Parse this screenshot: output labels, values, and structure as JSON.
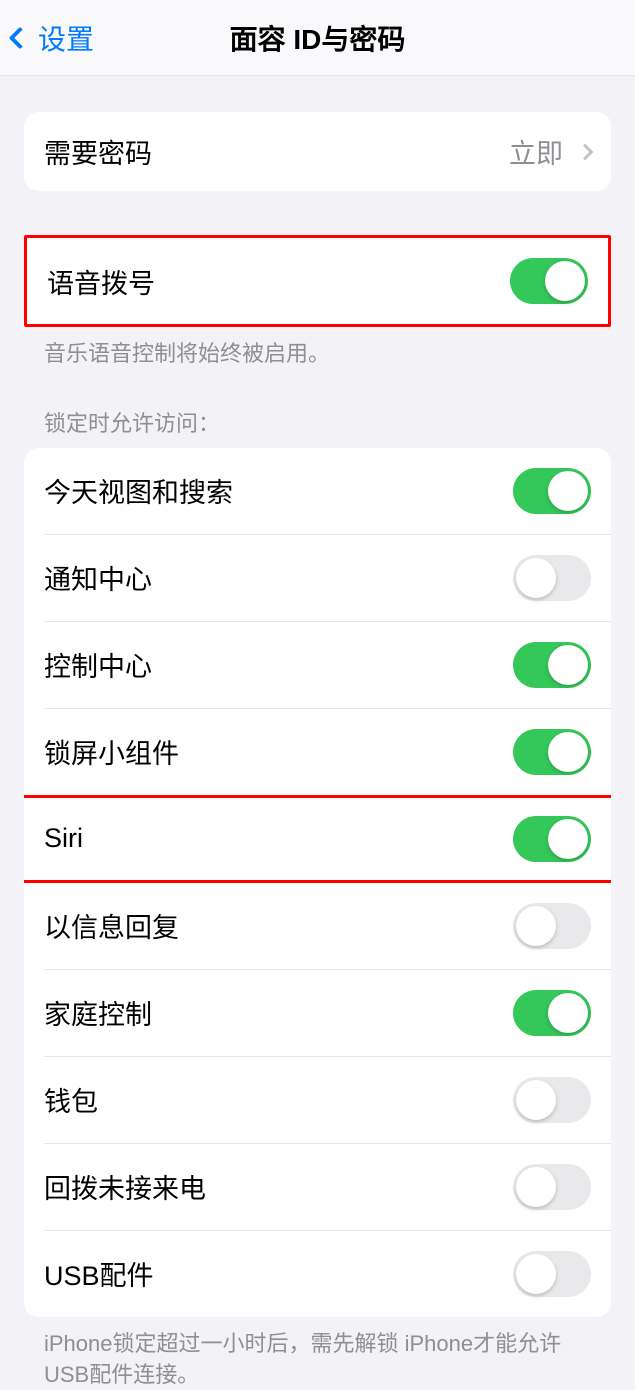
{
  "header": {
    "back_label": "设置",
    "title": "面容 ID与密码"
  },
  "require_passcode": {
    "label": "需要密码",
    "value": "立即"
  },
  "voice_dial": {
    "label": "语音拨号",
    "on": true,
    "footer": "音乐语音控制将始终被启用。"
  },
  "lock_access": {
    "header": "锁定时允许访问：",
    "items": [
      {
        "label": "今天视图和搜索",
        "on": true
      },
      {
        "label": "通知中心",
        "on": false
      },
      {
        "label": "控制中心",
        "on": true
      },
      {
        "label": "锁屏小组件",
        "on": true
      },
      {
        "label": "Siri",
        "on": true
      },
      {
        "label": "以信息回复",
        "on": false
      },
      {
        "label": "家庭控制",
        "on": true
      },
      {
        "label": "钱包",
        "on": false
      },
      {
        "label": "回拨未接来电",
        "on": false
      },
      {
        "label": "USB配件",
        "on": false
      }
    ],
    "footer": "iPhone锁定超过一小时后，需先解锁 iPhone才能允许USB配件连接。"
  }
}
